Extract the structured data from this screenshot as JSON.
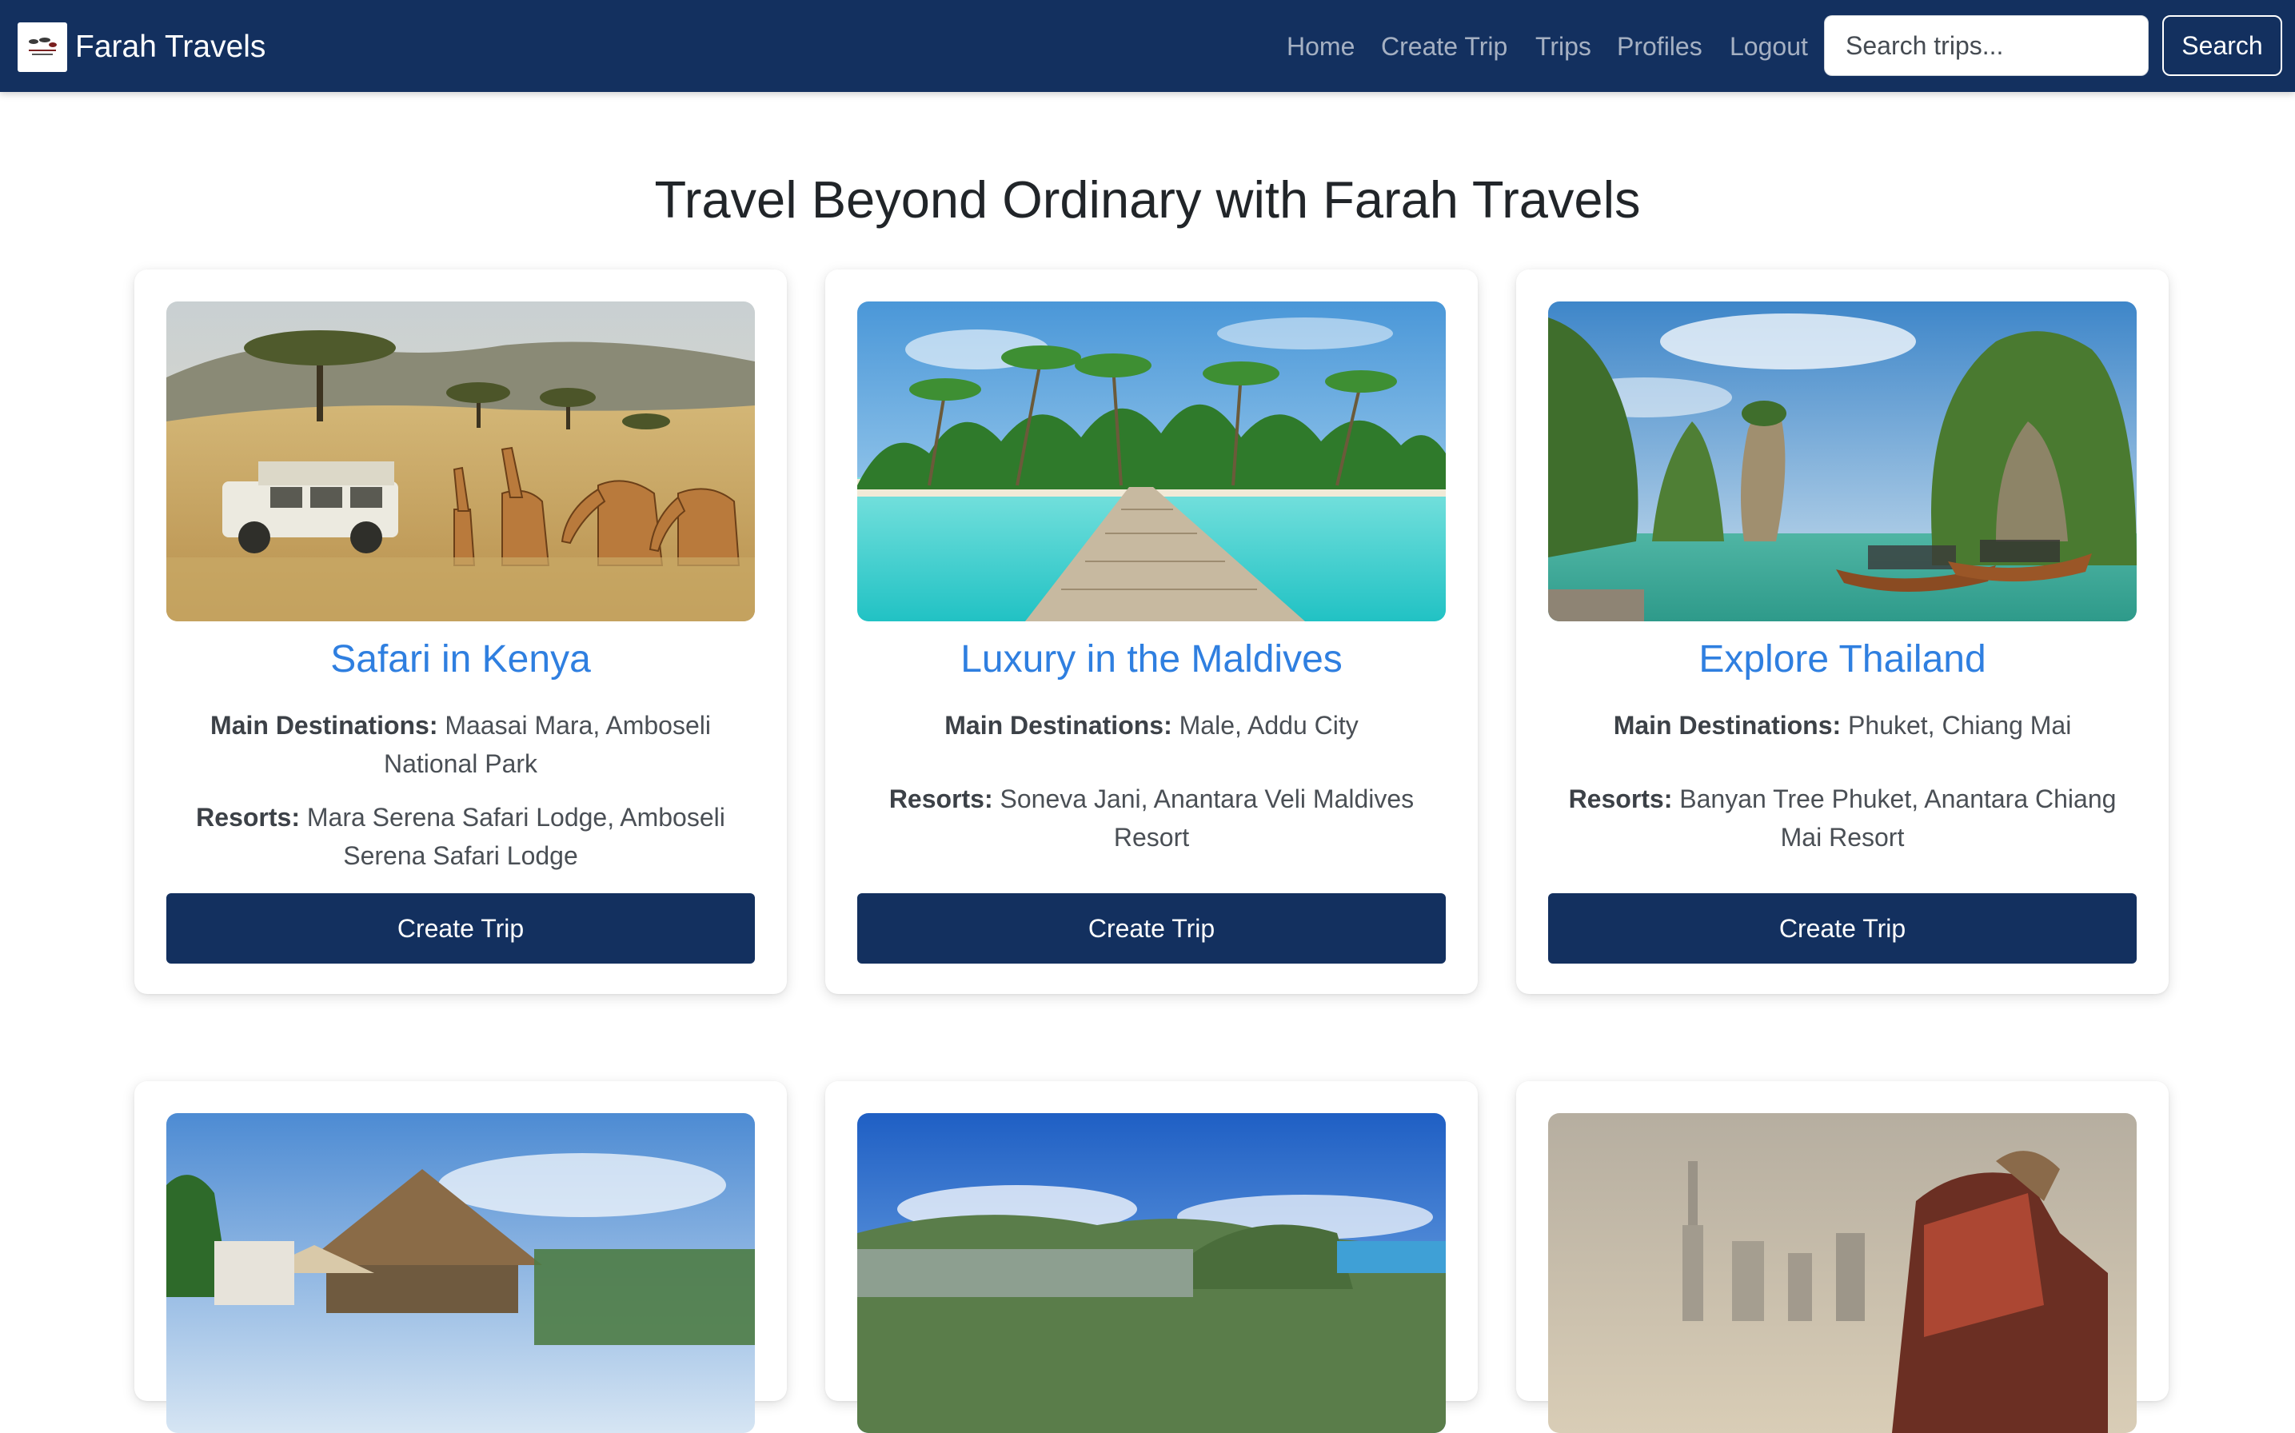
{
  "navbar": {
    "brand_title": "Farah Travels",
    "logo_text": "Farah Travels",
    "links": [
      "Home",
      "Create Trip",
      "Trips",
      "Profiles",
      "Logout"
    ],
    "search_placeholder": "Search trips...",
    "search_button": "Search",
    "background_color": "#13305f"
  },
  "page": {
    "title": "Travel Beyond Ordinary with Farah Travels"
  },
  "cards": [
    {
      "title": "Safari in Kenya",
      "destinations_label": "Main Destinations:",
      "destinations": "Maasai Mara, Amboseli National Park",
      "resorts_label": "Resorts:",
      "resorts": "Mara Serena Safari Lodge, Amboseli Serena Safari Lodge",
      "button": "Create Trip"
    },
    {
      "title": "Luxury in the Maldives",
      "destinations_label": "Main Destinations:",
      "destinations": "Male, Addu City",
      "resorts_label": "Resorts:",
      "resorts": "Soneva Jani, Anantara Veli Maldives Resort",
      "button": "Create Trip"
    },
    {
      "title": "Explore Thailand",
      "destinations_label": "Main Destinations:",
      "destinations": "Phuket, Chiang Mai",
      "resorts_label": "Resorts:",
      "resorts": "Banyan Tree Phuket, Anantara Chiang Mai Resort",
      "button": "Create Trip"
    }
  ],
  "accent_colors": {
    "title_link": "#2f7fe0",
    "primary_button": "#13305f"
  }
}
